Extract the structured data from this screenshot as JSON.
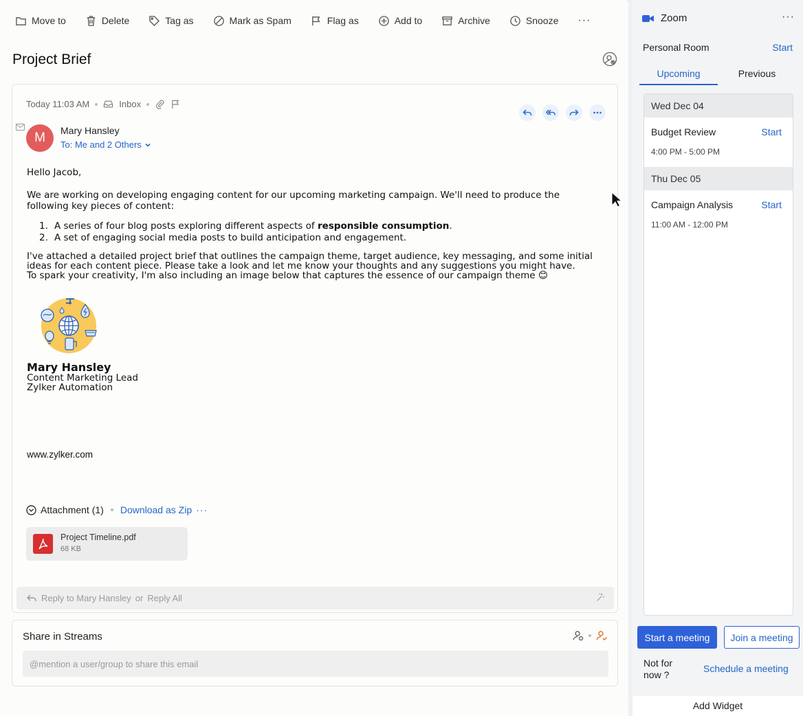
{
  "toolbar": {
    "move_to": "Move to",
    "delete": "Delete",
    "tag_as": "Tag as",
    "mark_spam": "Mark as Spam",
    "flag_as": "Flag as",
    "add_to": "Add to",
    "archive": "Archive",
    "snooze": "Snooze",
    "more": "···"
  },
  "message": {
    "subject": "Project Brief",
    "time": "Today 11:03 AM",
    "folder": "Inbox",
    "avatar_initial": "M",
    "avatar_color": "#e35c5c",
    "sender": "Mary Hansley",
    "recipients": "To: Me and 2 Others",
    "greeting": "Hello Jacob,",
    "para1": "We are working on developing engaging content for our upcoming marketing campaign. We'll need to produce the following key pieces of content:",
    "list": [
      {
        "num": "1.",
        "text_before": "A series of four blog posts exploring different aspects of ",
        "bold": "responsible consumption",
        "text_after": "."
      },
      {
        "num": "2.",
        "text": "A set of engaging social media posts to build anticipation and engagement."
      }
    ],
    "para2_line1": "I've attached a detailed project brief that outlines the campaign theme, target audience, key messaging, and some initial ideas for each content piece. Please take a look and let me know your thoughts and any suggestions you might have.",
    "para2_line2": "To spark your creativity, I'm also including an image below that captures the essence of our campaign theme 😊",
    "signature": {
      "name": "Mary Hansley",
      "title": "Content Marketing Lead",
      "company": "Zylker Automation"
    },
    "website": "www.zylker.com"
  },
  "attachments": {
    "header": "Attachment (1)",
    "download_zip": "Download as Zip",
    "more": "···",
    "files": [
      {
        "name": "Project Timeline.pdf",
        "size": "68 KB"
      }
    ]
  },
  "reply": {
    "reply_to": "Reply to Mary Hansley",
    "or": "or",
    "reply_all": "Reply All"
  },
  "streams": {
    "title": "Share in Streams",
    "placeholder": "@mention a user/group to share this email"
  },
  "zoom": {
    "title": "Zoom",
    "more": "···",
    "personal_room": "Personal Room",
    "personal_room_start": "Start",
    "tabs": [
      {
        "label": "Upcoming",
        "active": true
      },
      {
        "label": "Previous",
        "active": false
      }
    ],
    "days": [
      {
        "date": "Wed Dec 04",
        "meetings": [
          {
            "title": "Budget Review",
            "time": "4:00 PM - 5:00 PM",
            "action": "Start"
          }
        ]
      },
      {
        "date": "Thu Dec 05",
        "meetings": [
          {
            "title": "Campaign Analysis",
            "time": "11:00 AM - 12:00 PM",
            "action": "Start"
          }
        ]
      }
    ],
    "start_meeting": "Start a meeting",
    "join_meeting": "Join a meeting",
    "not_now": "Not for now ?",
    "schedule": "Schedule a meeting",
    "add_widget": "Add Widget",
    "accent": "#2f62d8"
  }
}
